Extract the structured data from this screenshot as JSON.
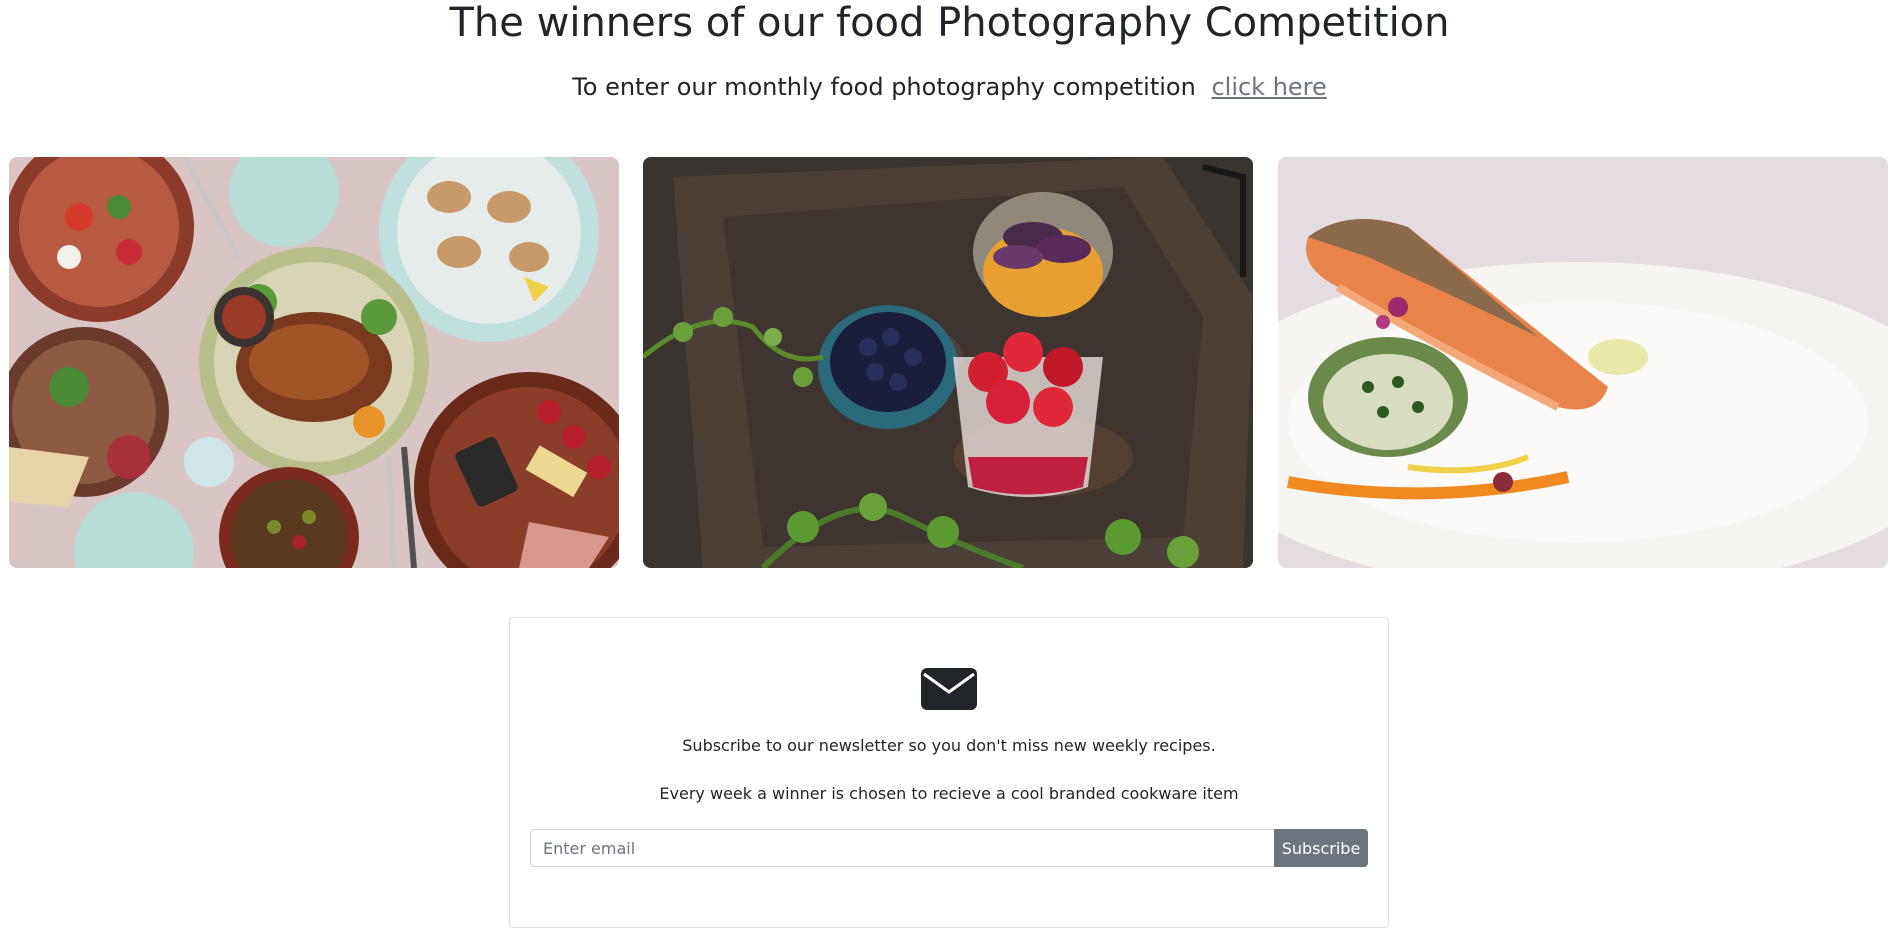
{
  "header": {
    "title": "The winners of our food Photography Competition",
    "subtitle_text": "To enter our monthly food photography competition",
    "subtitle_link": "click here"
  },
  "gallery": {
    "photos": [
      {
        "subject": "table spread with salad, roast meat, oysters and charcuterie"
      },
      {
        "subject": "dark tray with blueberries, raspberry parfait and plum dessert"
      },
      {
        "subject": "salmon fillet with herb rice on a white plate"
      }
    ]
  },
  "newsletter": {
    "icon": "envelope-icon",
    "line_1": "Subscribe to our newsletter so you don't miss new weekly recipes.",
    "line_2": "Every week a winner is chosen to recieve a cool branded cookware item",
    "email_value": "",
    "email_placeholder": "Enter email",
    "subscribe_label": "Subscribe"
  },
  "colors": {
    "text": "#212529",
    "link": "#6c757d",
    "button": "#6c757d",
    "border": "#dee2e6"
  }
}
